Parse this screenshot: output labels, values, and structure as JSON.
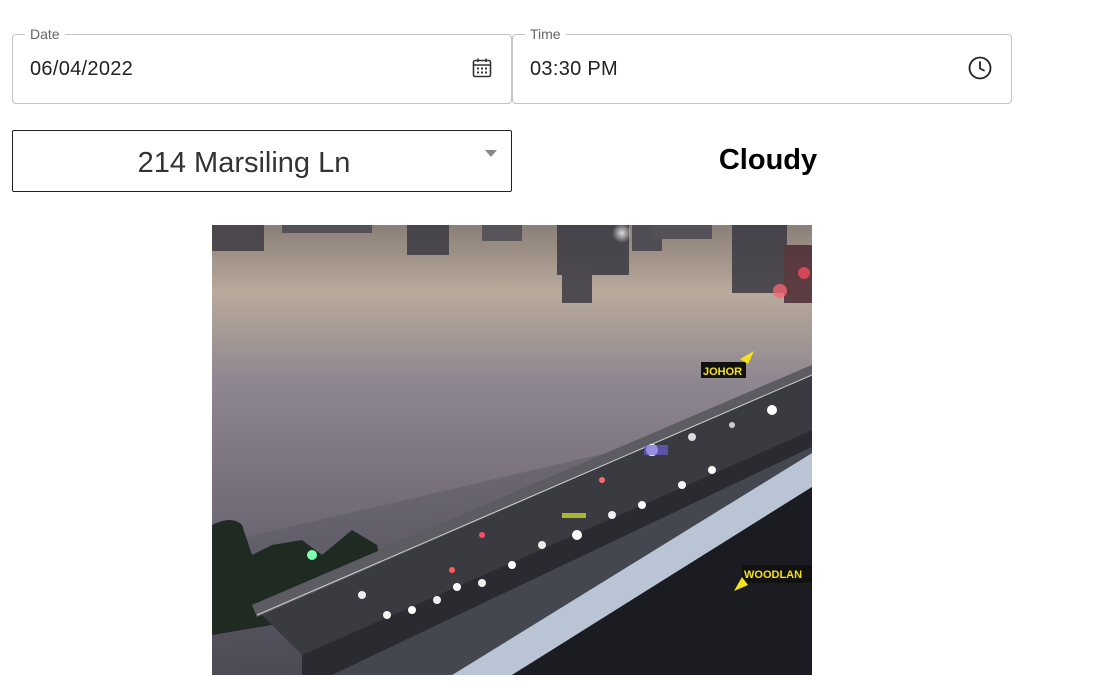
{
  "date": {
    "label": "Date",
    "value": "06/04/2022",
    "icon": "calendar-icon"
  },
  "time": {
    "label": "Time",
    "value": "03:30 PM",
    "icon": "clock-icon"
  },
  "location": {
    "selected": "214 Marsiling Ln",
    "icon": "chevron-down-icon"
  },
  "weather": {
    "condition": "Cloudy"
  },
  "camera": {
    "overlay_labels": {
      "johor": "JOHOR",
      "woodlands": "WOODLAN"
    },
    "colors": {
      "label_bg": "#111111",
      "label_text": "#f5e11a"
    }
  }
}
